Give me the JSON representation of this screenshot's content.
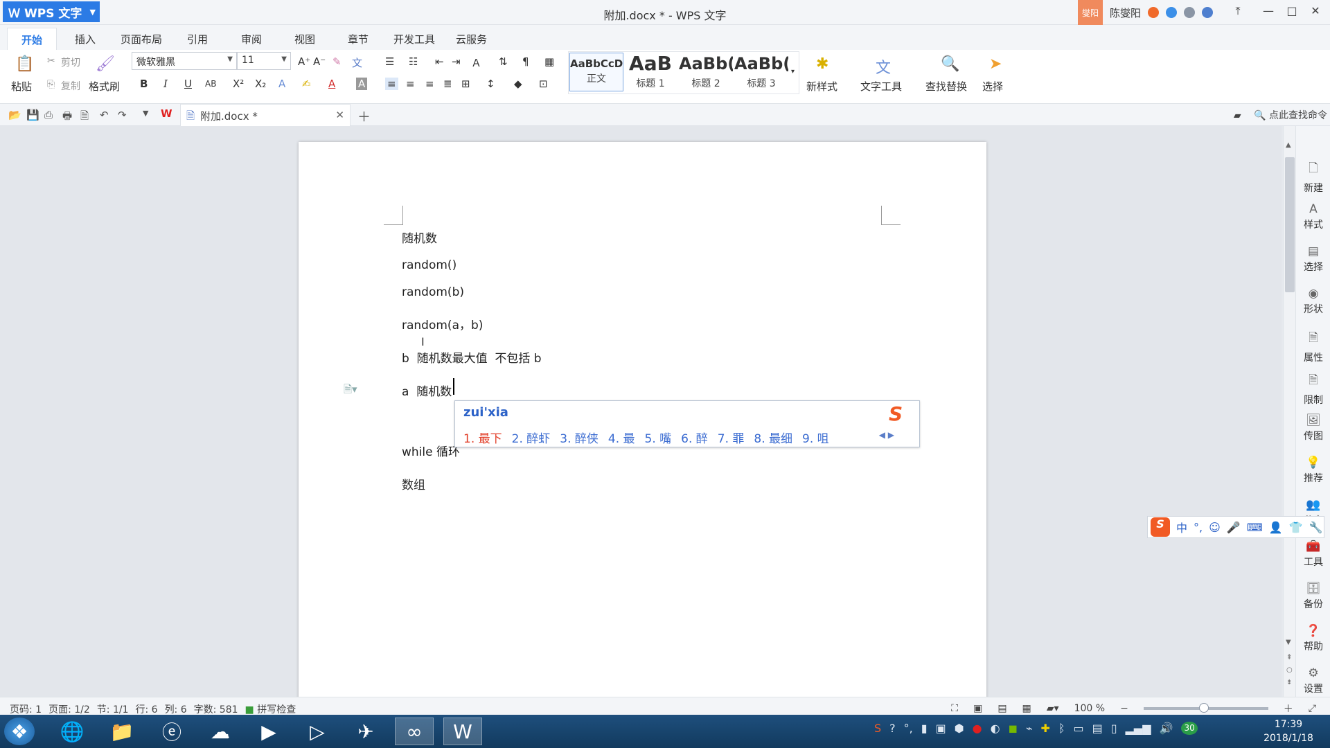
{
  "app": {
    "name": "WPS 文字",
    "window_title": "附加.docx * - WPS 文字"
  },
  "user": {
    "badge": "燮阳",
    "name": "陈燮阳"
  },
  "ribbon_tabs": [
    "开始",
    "插入",
    "页面布局",
    "引用",
    "审阅",
    "视图",
    "章节",
    "开发工具",
    "云服务"
  ],
  "clipboard": {
    "paste": "粘贴",
    "cut": "剪切",
    "copy": "复制",
    "format_painter": "格式刷"
  },
  "font": {
    "name": "微软雅黑",
    "size": "11"
  },
  "styles": [
    {
      "sample": "AaBbCcD",
      "label": "正文"
    },
    {
      "sample": "AaB",
      "label": "标题 1"
    },
    {
      "sample": "AaBb(",
      "label": "标题 2"
    },
    {
      "sample": "AaBb(",
      "label": "标题 3"
    }
  ],
  "ribbon_buttons": {
    "new_style": "新样式",
    "text_tools": "文字工具",
    "find_replace": "查找替换",
    "select": "选择"
  },
  "doc_tab": {
    "name": "附加.docx *"
  },
  "search_cmd": "点此查找命令",
  "document_lines": [
    "随机数",
    "random()",
    "random(b)",
    "random(a，b)",
    "b  随机数最大值  不包括 b",
    "a  随机数",
    "while 循环",
    "数组"
  ],
  "ime": {
    "composition": "zui'xia",
    "candidates": [
      "1. 最下",
      "2. 醉虾",
      "3. 醉侠",
      "4. 最",
      "5. 嘴",
      "6. 醉",
      "7. 罪",
      "8. 最细",
      "9. 咀"
    ],
    "bar": [
      "中",
      "°,"
    ]
  },
  "right_panel": [
    "新建",
    "样式",
    "选择",
    "形状",
    "属性",
    "限制",
    "传图",
    "推荐",
    "分享",
    "工具",
    "备份",
    "帮助",
    "设置"
  ],
  "status": {
    "page_code": "页码: 1",
    "page": "页面: 1/2",
    "section": "节: 1/1",
    "row": "行: 6",
    "col": "列: 6",
    "word_count": "字数: 581",
    "spell_check": "拼写检查",
    "zoom": "100 %"
  },
  "clock": {
    "time": "17:39",
    "date": "2018/1/18"
  },
  "tray_badge": "30"
}
